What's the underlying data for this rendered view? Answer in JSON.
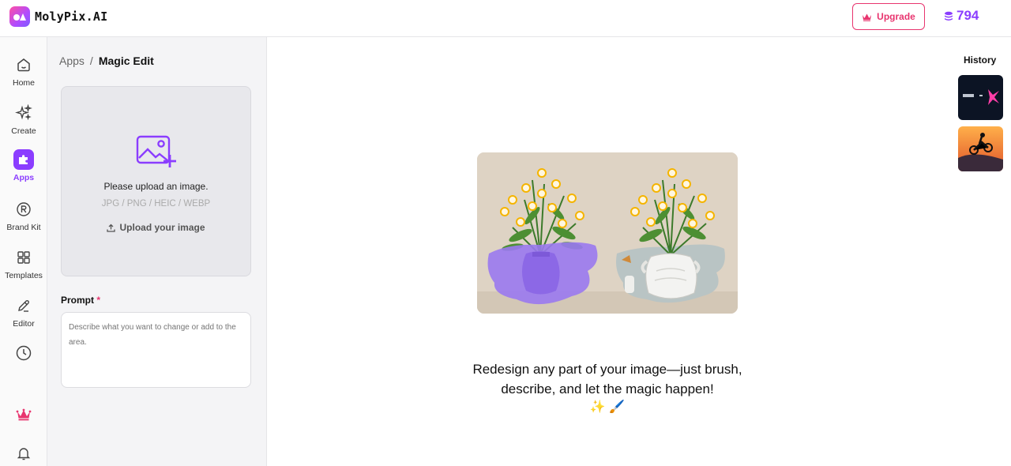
{
  "app": {
    "name": "MolyPix.AI"
  },
  "header": {
    "upgrade_label": "Upgrade",
    "credits": "794"
  },
  "rail": {
    "items": [
      {
        "label": "Home",
        "icon": "home-icon"
      },
      {
        "label": "Create",
        "icon": "sparkles-icon"
      },
      {
        "label": "Apps",
        "icon": "puzzle-icon",
        "active": true
      },
      {
        "label": "Brand Kit",
        "icon": "registered-icon"
      },
      {
        "label": "Templates",
        "icon": "grid-icon"
      },
      {
        "label": "Editor",
        "icon": "pencil-icon"
      }
    ]
  },
  "panel": {
    "breadcrumb": {
      "root": "Apps",
      "sep": "/",
      "current": "Magic Edit"
    },
    "upload": {
      "title": "Please upload an image.",
      "formats": "JPG / PNG / HEIC / WEBP",
      "action": "Upload your image"
    },
    "prompt": {
      "label": "Prompt",
      "required_mark": "*",
      "placeholder": "Describe what you want to change or add to the area."
    }
  },
  "main": {
    "tagline": "Redesign any part of your image—just brush, describe, and let the magic happen!",
    "emojis": "✨ 🖌️",
    "history_title": "History"
  },
  "colors": {
    "accent": "#8b3dff",
    "pink": "#e8356f",
    "mask": "#9a79f0"
  }
}
